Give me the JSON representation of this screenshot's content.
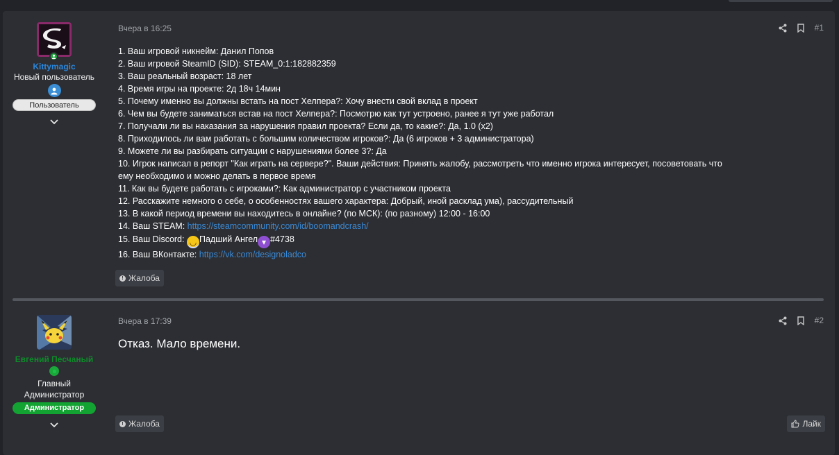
{
  "posts": [
    {
      "author": {
        "name": "Kittymagic",
        "title": "Новый пользователь",
        "badge": "Пользователь",
        "name_color": "#2b86db"
      },
      "date": "Вчера в 16:25",
      "number": "#1",
      "lines": [
        "1. Ваш игровой никнейм: Данил Попов",
        "2. Ваш игровой SteamID (SID): STEAM_0:1:182882359",
        "3. Ваш реальный возраст: 18 лет",
        "4. Время игры на проекте: 2д 18ч 14мин",
        "5. Почему именно вы должны встать на пост Хелпера?: Хочу внести свой вклад в проект",
        "6. Чем вы будете заниматься встав на пост Хелпера?: Посмотрю как тут устроено, ранее я тут уже работал",
        "7. Получали ли вы наказания за нарушения правил проекта? Если да, то какие?: Да, 1.0 (x2)",
        "8. Приходилось ли вам работать с большим количеством игроков?: Да (6 игроков + 3 администратора)",
        "9. Можете ли вы разбирать ситуации с нарушениями более 3?: Да",
        "10. Игрок написал в репорт \"Как играть на сервере?\". Ваши действия: Принять жалобу, рассмотреть что именно игрока интересует, посоветовать что ему необходимо и можно делать в первое время",
        "11. Как вы будете работать с игроками?: Как администратор с участником проекта",
        "12. Расскажите немного о себе, о особенностях вашего характера: Добрый, иной расклад ума), рассудительный",
        "13. В какой период времени вы находитесь в онлайне? (по МСК): (по разному) 12:00 - 16:00"
      ],
      "steam_label": "14. Ваш STEAM: ",
      "steam_link": "https://steamcommunity.com/id/boomandcrash/",
      "discord_label": "15. Ваш Discord: ",
      "discord_name": "Падший Ангел",
      "discord_tag": "#4738",
      "vk_label": "16. Ваш ВКонтакте: ",
      "vk_link": "https://vk.com/designoladco",
      "report_label": "Жалоба"
    },
    {
      "author": {
        "name": "Евгений Песчаный",
        "title": "Главный Администратор",
        "badge": "Администратор",
        "name_color": "#0f8a2a"
      },
      "date": "Вчера в 17:39",
      "number": "#2",
      "body": "Отказ. Мало времени.",
      "report_label": "Жалоба",
      "like_label": "Лайк"
    }
  ],
  "icons": {
    "share": "share-icon",
    "bookmark": "bookmark-icon",
    "chevron": "chevron-down-icon",
    "report": "info-icon",
    "like": "thumbs-up-icon"
  }
}
